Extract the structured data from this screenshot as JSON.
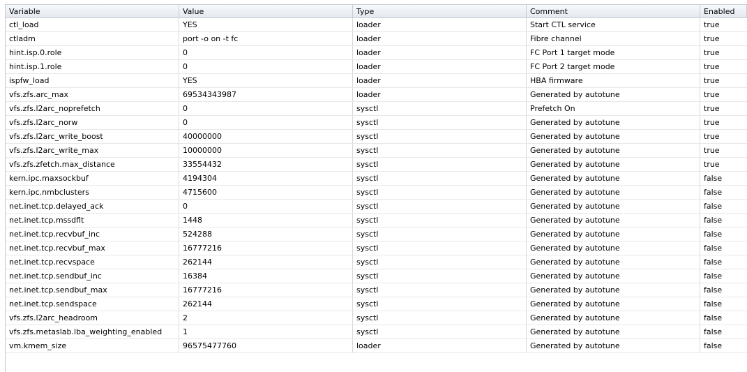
{
  "table": {
    "columns": [
      "Variable",
      "Value",
      "Type",
      "Comment",
      "Enabled"
    ],
    "rows": [
      [
        "ctl_load",
        "YES",
        "loader",
        "Start CTL service",
        "true"
      ],
      [
        "ctladm",
        "port -o on -t fc",
        "loader",
        "Fibre channel",
        "true"
      ],
      [
        "hint.isp.0.role",
        "0",
        "loader",
        "FC Port 1 target mode",
        "true"
      ],
      [
        "hint.isp.1.role",
        "0",
        "loader",
        "FC Port 2 target mode",
        "true"
      ],
      [
        "ispfw_load",
        "YES",
        "loader",
        "HBA firmware",
        "true"
      ],
      [
        "vfs.zfs.arc_max",
        "69534343987",
        "loader",
        "Generated by autotune",
        "true"
      ],
      [
        "vfs.zfs.l2arc_noprefetch",
        "0",
        "sysctl",
        "Prefetch On",
        "true"
      ],
      [
        "vfs.zfs.l2arc_norw",
        "0",
        "sysctl",
        "Generated by autotune",
        "true"
      ],
      [
        "vfs.zfs.l2arc_write_boost",
        "40000000",
        "sysctl",
        "Generated by autotune",
        "true"
      ],
      [
        "vfs.zfs.l2arc_write_max",
        "10000000",
        "sysctl",
        "Generated by autotune",
        "true"
      ],
      [
        "vfs.zfs.zfetch.max_distance",
        "33554432",
        "sysctl",
        "Generated by autotune",
        "true"
      ],
      [
        "kern.ipc.maxsockbuf",
        "4194304",
        "sysctl",
        "Generated by autotune",
        "false"
      ],
      [
        "kern.ipc.nmbclusters",
        "4715600",
        "sysctl",
        "Generated by autotune",
        "false"
      ],
      [
        "net.inet.tcp.delayed_ack",
        "0",
        "sysctl",
        "Generated by autotune",
        "false"
      ],
      [
        "net.inet.tcp.mssdflt",
        "1448",
        "sysctl",
        "Generated by autotune",
        "false"
      ],
      [
        "net.inet.tcp.recvbuf_inc",
        "524288",
        "sysctl",
        "Generated by autotune",
        "false"
      ],
      [
        "net.inet.tcp.recvbuf_max",
        "16777216",
        "sysctl",
        "Generated by autotune",
        "false"
      ],
      [
        "net.inet.tcp.recvspace",
        "262144",
        "sysctl",
        "Generated by autotune",
        "false"
      ],
      [
        "net.inet.tcp.sendbuf_inc",
        "16384",
        "sysctl",
        "Generated by autotune",
        "false"
      ],
      [
        "net.inet.tcp.sendbuf_max",
        "16777216",
        "sysctl",
        "Generated by autotune",
        "false"
      ],
      [
        "net.inet.tcp.sendspace",
        "262144",
        "sysctl",
        "Generated by autotune",
        "false"
      ],
      [
        "vfs.zfs.l2arc_headroom",
        "2",
        "sysctl",
        "Generated by autotune",
        "false"
      ],
      [
        "vfs.zfs.metaslab.lba_weighting_enabled",
        "1",
        "sysctl",
        "Generated by autotune",
        "false"
      ],
      [
        "vm.kmem_size",
        "96575477760",
        "loader",
        "Generated by autotune",
        "false"
      ]
    ]
  }
}
